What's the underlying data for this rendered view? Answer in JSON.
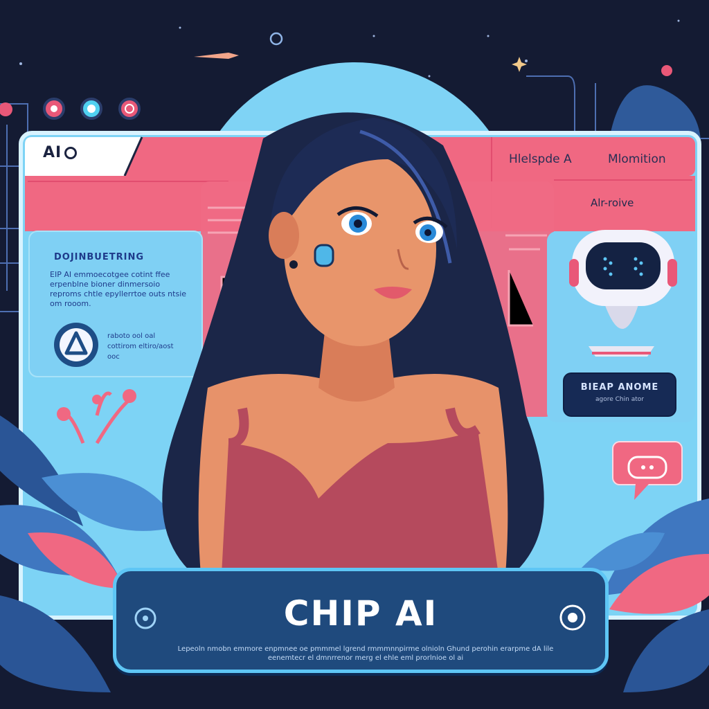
{
  "header": {
    "logo_text": "AI",
    "nav": [
      "Hlelspde A",
      "Mlomition"
    ]
  },
  "left_panel": {
    "title": "DOJINBUETRING",
    "body": "EIP AI emmoecotgee cotint ffee erpenblne bioner dinmersoio reproms chtle epyllerrtoe outs ntsie om rooom.",
    "small": "raboto ool oal cottirom eltiro/aost ooc"
  },
  "right_panel": {
    "subtitle": "Alr-roive",
    "status_title": "BIEAP ANOME",
    "status_sub": "agore Chin ator"
  },
  "banner": {
    "title": "CHIP AI",
    "caption": "Lepeoln nmobn emmore enpmnee oe pmmmel lgrend rmmmnnpirme olnioln Ghund perohin erarpme dA lile eenemtecr el dmnrrenor merg el ehle eml prorlnioe ol ai"
  },
  "colors": {
    "background": "#141b33",
    "panel_pink": "#f06882",
    "panel_blue": "#7dd3f5",
    "accent_cyan": "#5ec6f5",
    "banner_navy": "#1f4a7d"
  },
  "icons": [
    "record-icon",
    "target-icon",
    "warning-triangle-icon",
    "chat-bubble-icon",
    "robot-assistant-icon"
  ]
}
